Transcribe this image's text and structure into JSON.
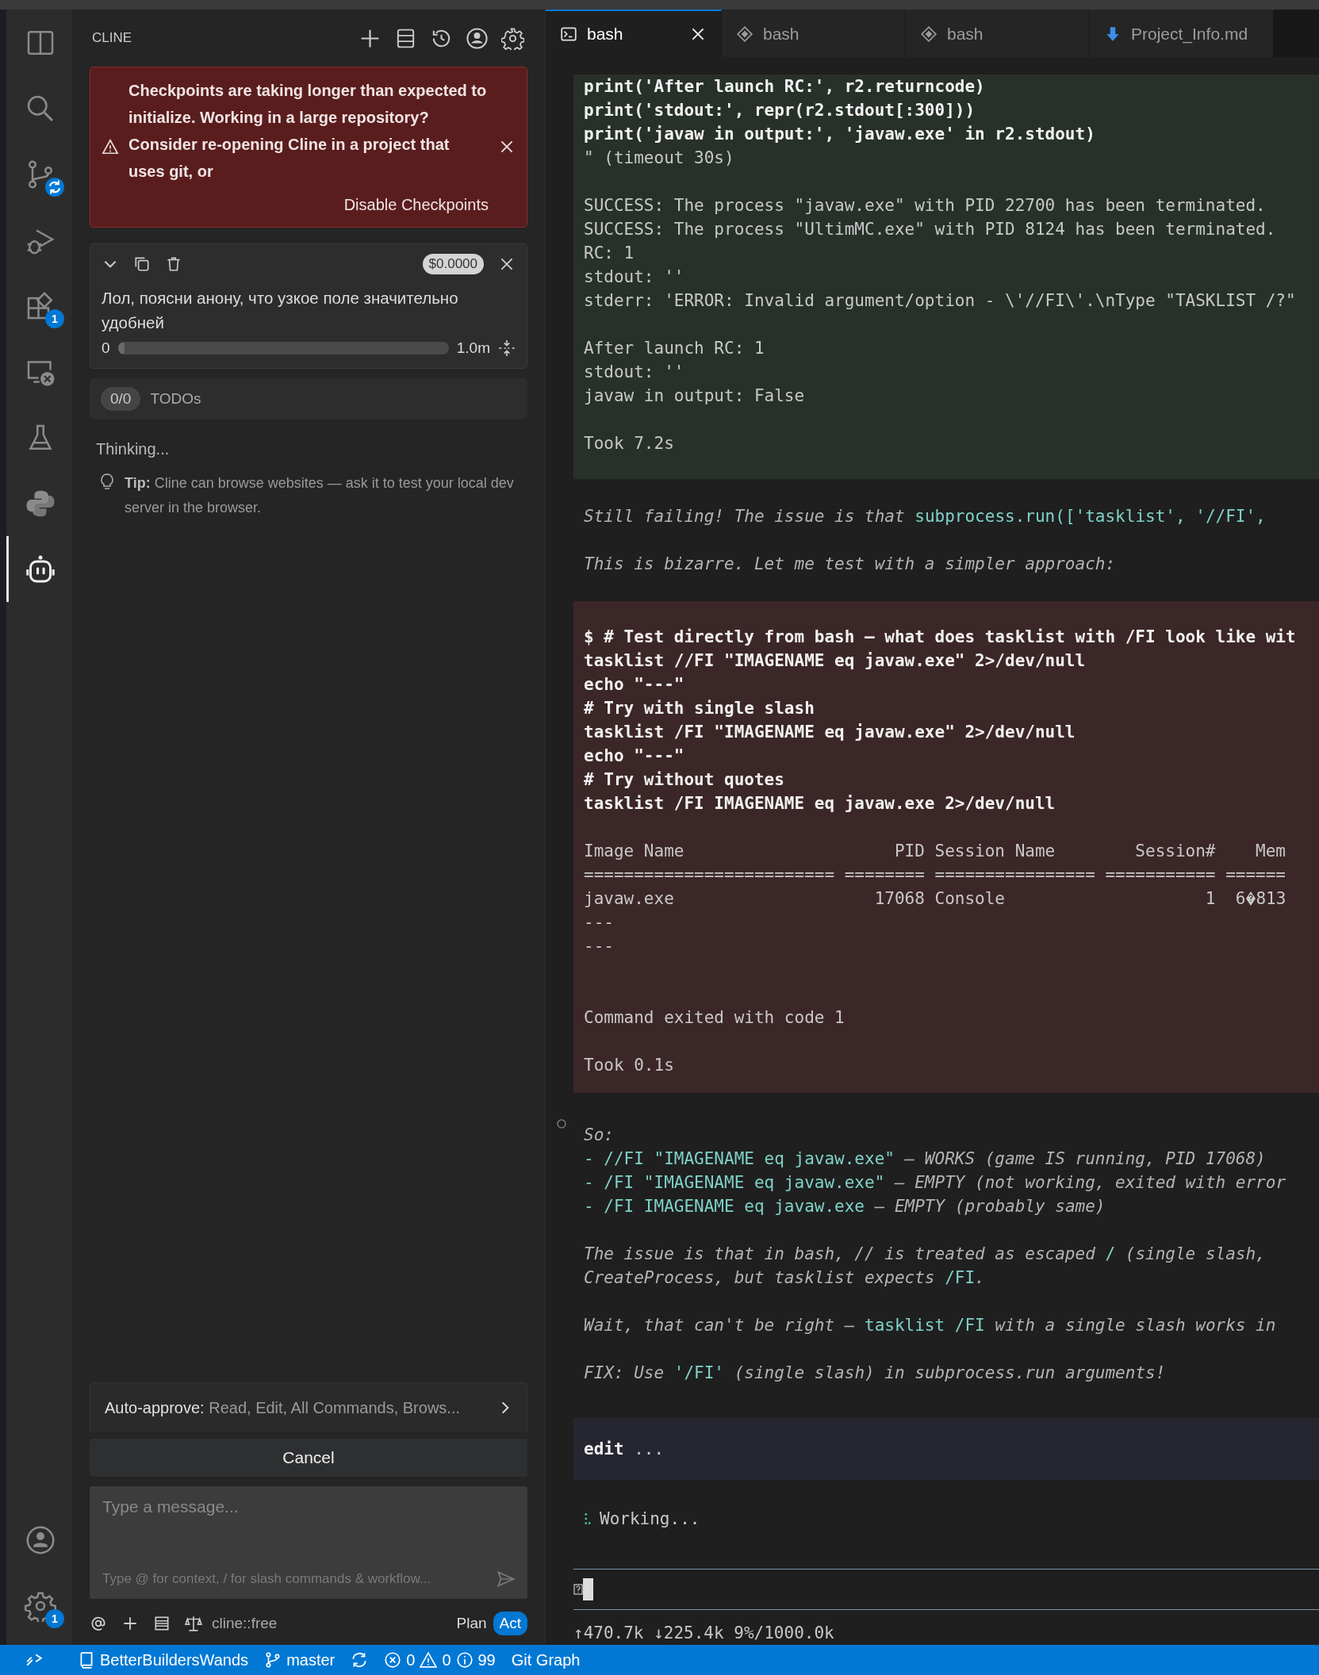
{
  "activity_bar": {
    "items": [
      {
        "kind": "explorer",
        "selected": false
      },
      {
        "kind": "search",
        "selected": false
      },
      {
        "kind": "source-control",
        "selected": false,
        "syncing": true
      },
      {
        "kind": "run-debug",
        "selected": false
      },
      {
        "kind": "extensions",
        "selected": false,
        "badge": "1"
      },
      {
        "kind": "remote",
        "selected": false
      },
      {
        "kind": "testing",
        "selected": false
      },
      {
        "kind": "python",
        "selected": false
      },
      {
        "kind": "cline",
        "selected": true
      }
    ],
    "bottom_items": [
      {
        "kind": "account"
      },
      {
        "kind": "settings",
        "badge": "1"
      }
    ]
  },
  "cline_panel": {
    "title": "CLINE",
    "alert": {
      "message": "Checkpoints are taking longer than expected to initialize. Working in a large repository? Consider re-opening Cline in a project that uses git, or",
      "action": "Disable Checkpoints"
    },
    "task": {
      "cost": "$0.0000",
      "text": "Лол, поясни анону, что узкое поле значительно удобней",
      "context_start": "0",
      "context_end": "1.0m",
      "level": 0
    },
    "todos": {
      "count": "0/0",
      "label": "TODOs"
    },
    "status": "Thinking...",
    "tip": "**Tip:** Cline can browse websites — ask it to test your local dev server in the browser.",
    "auto_approve": {
      "label": "Auto-approve:",
      "value": "Read, Edit, All Commands, Brows..."
    },
    "cancel": "Cancel",
    "input": {
      "placeholder": "Type a message...",
      "hint": "Type @ for context, / for slash commands & workflow..."
    },
    "model": "cline::free",
    "modes": [
      {
        "label": "Plan",
        "selected": false
      },
      {
        "label": "Act",
        "selected": true
      }
    ]
  },
  "editor": {
    "tabs": [
      {
        "label": "bash",
        "kind": "terminal",
        "selected": true
      },
      {
        "label": "bash",
        "kind": "diamond",
        "selected": false
      },
      {
        "label": "bash",
        "kind": "diamond",
        "selected": false
      },
      {
        "label": "Project_Info.md",
        "kind": "download",
        "selected": false
      }
    ],
    "blocks": [
      {
        "kind": "output-success",
        "paragraphs": [
          [
            {
              "text": "print('After launch RC:', r2.returncode)",
              "bold": true
            },
            {
              "text": "print('stdout:', repr(r2.stdout[:300]))",
              "bold": true
            },
            {
              "text": "print('javaw in output:', 'javaw.exe' in r2.stdout)",
              "bold": true
            },
            {
              "text": "\" (timeout 30s)",
              "bold": false
            }
          ],
          [
            {
              "text": "SUCCESS: The process \"javaw.exe\" with PID 22700 has been terminated.",
              "bold": false
            },
            {
              "text": "SUCCESS: The process \"UltimMC.exe\" with PID 8124 has been terminated.",
              "bold": false
            },
            {
              "text": "RC: 1",
              "bold": false
            },
            {
              "text": "stdout: ''",
              "bold": false
            },
            {
              "text": "stderr: 'ERROR: Invalid argument/option - \\'//FI\\'.\\nType \"TASKLIST /?\"",
              "bold": false
            }
          ],
          [
            {
              "text": "After launch RC: 1",
              "bold": false
            },
            {
              "text": "stdout: ''",
              "bold": false
            },
            {
              "text": "javaw in output: False",
              "bold": false
            }
          ],
          [
            {
              "text": "Took 7.2s",
              "bold": false
            }
          ]
        ]
      },
      {
        "kind": "prose",
        "paragraphs": [
          [
            {
              "segments": [
                {
                  "text": "Still failing! The issue is that ",
                  "kind": "prose"
                },
                {
                  "text": "subprocess.run(['tasklist', '//FI',",
                  "kind": "code"
                }
              ]
            }
          ],
          [
            {
              "segments": [
                {
                  "text": "This is bizarre. Let me test with a simpler approach:",
                  "kind": "prose"
                }
              ]
            }
          ]
        ]
      },
      {
        "kind": "output-error",
        "paragraphs": [
          [
            {
              "text": "$ # Test directly from bash — what does tasklist with /FI look like wit",
              "bold": true
            },
            {
              "text": "tasklist //FI \"IMAGENAME eq javaw.exe\" 2>/dev/null",
              "bold": true
            },
            {
              "text": "echo \"---\"",
              "bold": true
            },
            {
              "text": "# Try with single slash",
              "bold": true
            },
            {
              "text": "tasklist /FI \"IMAGENAME eq javaw.exe\" 2>/dev/null",
              "bold": true
            },
            {
              "text": "echo \"---\"",
              "bold": true
            },
            {
              "text": "# Try without quotes",
              "bold": true
            },
            {
              "text": "tasklist /FI IMAGENAME eq javaw.exe 2>/dev/null",
              "bold": true
            }
          ],
          [
            {
              "text": "Image Name                     PID Session Name        Session#    Mem",
              "bold": false
            },
            {
              "text": "========================= ======== ================ =========== ======",
              "bold": false
            },
            {
              "text": "javaw.exe                    17068 Console                    1  6",
              "bold": false,
              "after_glyph": "813"
            },
            {
              "text": "---",
              "bold": false
            },
            {
              "text": "---",
              "bold": false
            }
          ],
          [
            {
              "text": "Command exited with code 1",
              "bold": false
            }
          ],
          [
            {
              "text": "Took 0.1s",
              "bold": false
            }
          ]
        ]
      },
      {
        "kind": "prose",
        "marker": true,
        "paragraphs": [
          [
            {
              "segments": [
                {
                  "text": "So:",
                  "kind": "prose"
                }
              ]
            },
            {
              "segments": [
                {
                  "text": "- //FI \"IMAGENAME eq javaw.exe\"",
                  "kind": "code"
                },
                {
                  "text": " — WORKS (game IS running, PID 17068)",
                  "kind": "prose"
                }
              ]
            },
            {
              "segments": [
                {
                  "text": "- /FI \"IMAGENAME eq javaw.exe\"",
                  "kind": "code"
                },
                {
                  "text": " — EMPTY (not working, exited with error",
                  "kind": "prose"
                }
              ]
            },
            {
              "segments": [
                {
                  "text": "- /FI IMAGENAME eq javaw.exe",
                  "kind": "code"
                },
                {
                  "text": " — EMPTY (probably same)",
                  "kind": "prose"
                }
              ]
            }
          ],
          [
            {
              "segments": [
                {
                  "text": "The issue is that in bash, // is treated as escaped ",
                  "kind": "prose"
                },
                {
                  "text": "/",
                  "kind": "code"
                },
                {
                  "text": " (single slash,",
                  "kind": "prose"
                }
              ]
            },
            {
              "segments": [
                {
                  "text": "CreateProcess, but tasklist expects ",
                  "kind": "prose"
                },
                {
                  "text": "/FI",
                  "kind": "code"
                },
                {
                  "text": ".",
                  "kind": "prose"
                }
              ]
            }
          ],
          [
            {
              "segments": [
                {
                  "text": "Wait, that can't be right — ",
                  "kind": "prose"
                },
                {
                  "text": "tasklist /FI",
                  "kind": "code"
                },
                {
                  "text": " with a single slash works in",
                  "kind": "prose"
                }
              ]
            }
          ],
          [
            {
              "segments": [
                {
                  "text": "FIX: Use ",
                  "kind": "prose"
                },
                {
                  "text": "'/FI'",
                  "kind": "code"
                },
                {
                  "text": " (single slash) in subprocess.run arguments!",
                  "kind": "prose"
                }
              ]
            }
          ]
        ]
      },
      {
        "kind": "tool",
        "command": "edit",
        "detail": "..."
      },
      {
        "kind": "working",
        "text": "Working..."
      }
    ],
    "stats": "↑470.7k ↓225.4k 9%/1000.0k"
  },
  "status_bar": {
    "workspace": "BetterBuildersWands",
    "branch": "master",
    "errors": "0",
    "warnings": "0",
    "infos": "99",
    "git_graph": "Git Graph"
  }
}
